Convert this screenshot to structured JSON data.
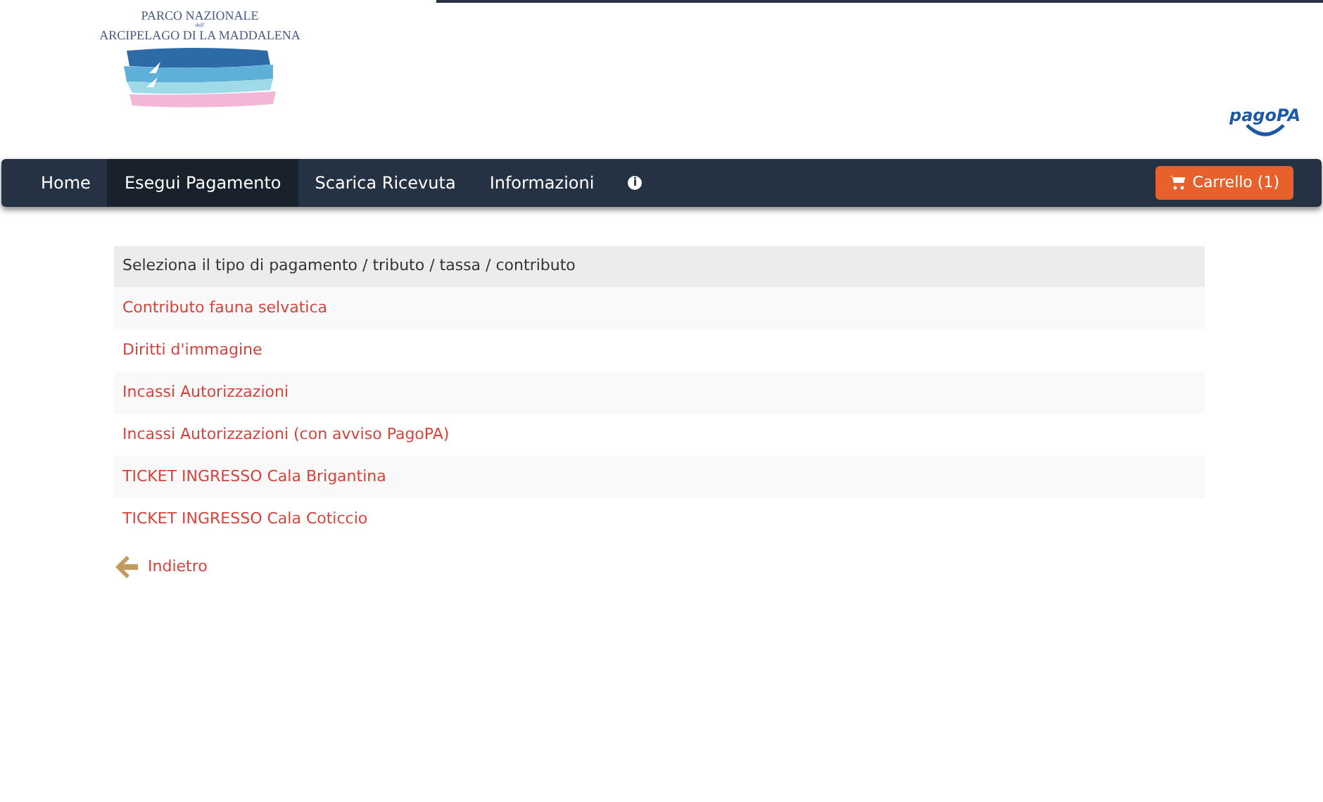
{
  "logo": {
    "line_1": "PARCO NAZIONALE",
    "line_2": "dell'",
    "line_3": "ARCIPELAGO DI LA MADDALENA"
  },
  "payment_logo": {
    "text": "pagoPA"
  },
  "navbar": {
    "items": [
      {
        "kind": "link",
        "label": "Home",
        "selected": false
      },
      {
        "kind": "link",
        "label": "Esegui Pagamento",
        "selected": true
      },
      {
        "kind": "link",
        "label": "Scarica Ricevuta",
        "selected": false
      },
      {
        "kind": "link",
        "label": "Informazioni",
        "selected": false
      },
      {
        "kind": "info",
        "label": "i",
        "selected": false
      }
    ],
    "cart": {
      "label": "Carrello (1)"
    }
  },
  "list": {
    "header": "Seleziona il tipo di pagamento / tributo / tassa / contributo",
    "items": [
      "Contributo fauna selvatica",
      "Diritti d'immagine",
      "Incassi Autorizzazioni",
      "Incassi Autorizzazioni (con avviso PagoPA)",
      "TICKET INGRESSO Cala Brigantina",
      "TICKET INGRESSO Cala Coticcio"
    ]
  },
  "back": {
    "label": "Indietro"
  }
}
